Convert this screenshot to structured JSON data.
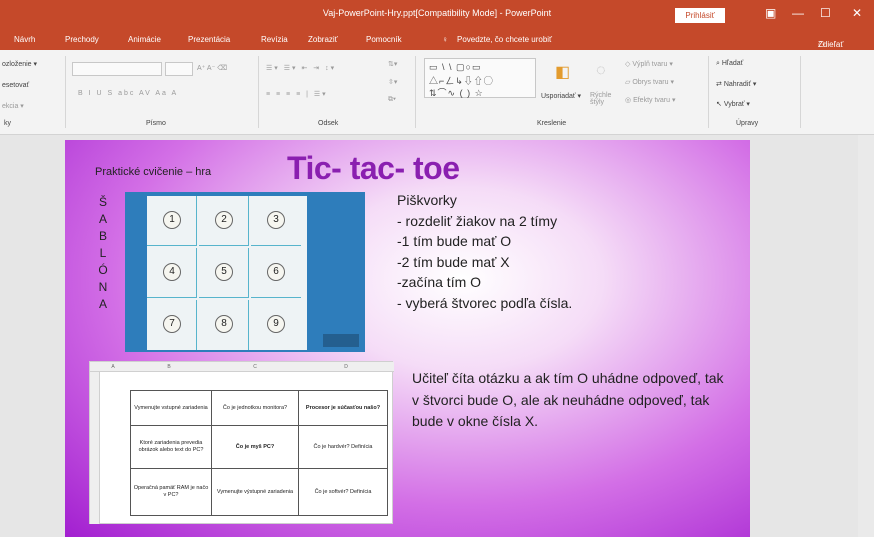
{
  "window": {
    "title": "Vaj-PowerPoint-Hry.ppt[Compatibility Mode] - PowerPoint",
    "signin": "Prihlásiť",
    "minimize": "—",
    "maximize": "☐",
    "close": "✕"
  },
  "menu": {
    "items": [
      "Návrh",
      "Prechody",
      "Animácie",
      "Prezentácia",
      "Revízia",
      "Zobraziť",
      "Pomocník"
    ],
    "tellme": "Povedzte, čo chcete urobiť",
    "share": "Zdieľať"
  },
  "ribbon": {
    "slides_group": {
      "layout": "ozloženie",
      "reset": "esetovať",
      "section": "ekcia",
      "label": "ky"
    },
    "font_group": {
      "label": "Písmo",
      "buttons": "B  I  U  S  abc  AV  Aa  A"
    },
    "paragraph_group": {
      "label": "Odsek"
    },
    "drawing_group": {
      "label": "Kreslenie",
      "arrange": "Usporiadať",
      "quickstyles": "Rýchle štýly",
      "fill": "Výplň tvaru",
      "outline": "Obrys tvaru",
      "effects": "Efekty tvaru"
    },
    "editing_group": {
      "label": "Úpravy",
      "find": "Hľadať",
      "replace": "Nahradiť",
      "select": "Vybrať"
    }
  },
  "slide": {
    "title": "Tic- tac- toe",
    "subtitle": "Praktické cvičenie – hra",
    "vertical_letters": [
      "Š",
      "A",
      "B",
      "L",
      "Ó",
      "N",
      "A"
    ],
    "grid_numbers": [
      "1",
      "2",
      "3",
      "4",
      "5",
      "6",
      "7",
      "8",
      "9"
    ],
    "rules": [
      "Piškvorky",
      "- rozdeliť žiakov na 2 tímy",
      "-1 tím bude mať O",
      "-2 tím bude mať X",
      "-začína tím O",
      "- vyberá štvorec podľa čísla."
    ],
    "paragraph": "Učiteľ číta otázku a ak tím O uhádne odpoveď, tak v štvorci bude O, ale ak neuhádne odpoveď, tak bude v okne čísla X.",
    "table_cols": [
      "A",
      "B",
      "C",
      "D"
    ],
    "table_cells": [
      "Vymenujte vstupné zariadenia",
      "Čo je jednotkou monitora?",
      "Procesor je súčasťou našo?",
      "Ktoré zariadenia prevedia obrázok alebo text do PC?",
      "Čo je myš PC?",
      "Čo je hardvér? Definícia",
      "Operačná pamäť RAM je načo v PC?",
      "Vymenujte výstupné zariadenia",
      "Čo je softvér? Definícia"
    ]
  }
}
